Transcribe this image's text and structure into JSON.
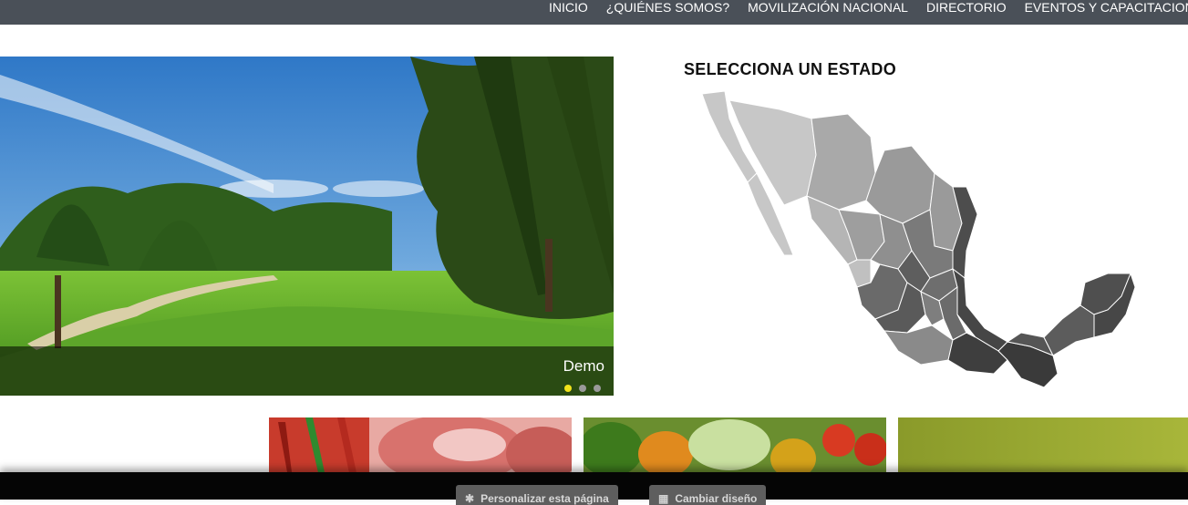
{
  "nav": {
    "items": [
      {
        "label": "INICIO"
      },
      {
        "label": "¿QUIÉNES SOMOS?"
      },
      {
        "label": "MOVILIZACIÓN NACIONAL"
      },
      {
        "label": "DIRECTORIO"
      },
      {
        "label": "EVENTOS Y CAPACITACIONES"
      }
    ]
  },
  "slider": {
    "caption": "Demo",
    "slide_count": 3,
    "active_index": 0
  },
  "map": {
    "title": "SELECCIONA UN ESTADO"
  },
  "footer_bar": {
    "customize_label": "Personalizar esta página",
    "layout_label": "Cambiar diseño",
    "customize_icon": "gear-icon",
    "layout_icon": "layout-icon"
  },
  "colors": {
    "nav_bg": "#4a5058",
    "dot_active": "#f2e31b",
    "bottom_bar": "#050505"
  }
}
